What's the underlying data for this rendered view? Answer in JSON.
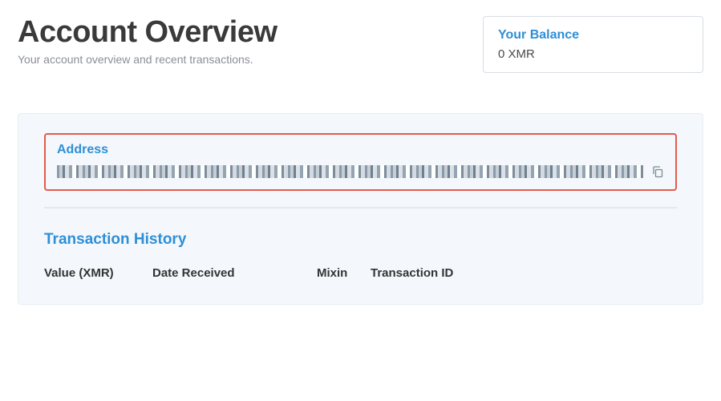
{
  "header": {
    "title": "Account Overview",
    "subtitle": "Your account overview and recent transactions."
  },
  "balance": {
    "title": "Your Balance",
    "value": "0 XMR"
  },
  "address": {
    "title": "Address",
    "value_obscured": true
  },
  "history": {
    "title": "Transaction History",
    "columns": {
      "value": "Value (XMR)",
      "date": "Date Received",
      "mixin": "Mixin",
      "txid": "Transaction ID"
    },
    "rows": []
  }
}
